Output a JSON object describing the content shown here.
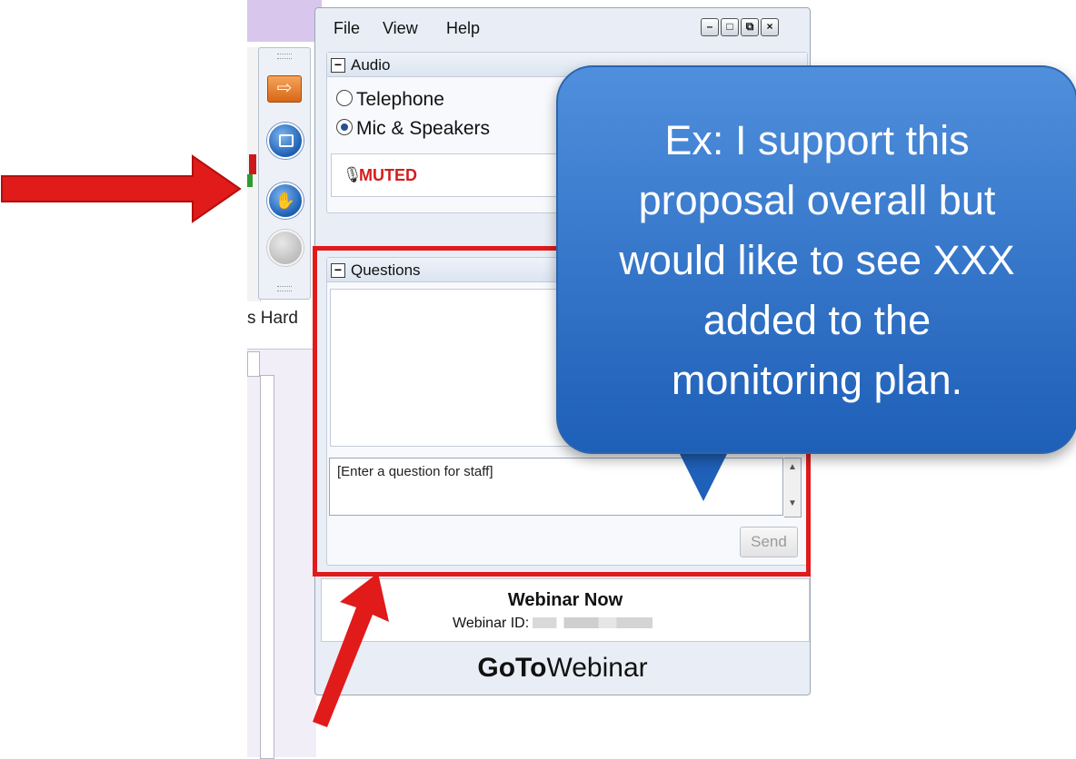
{
  "background_app": {
    "partial_label": "s Hard"
  },
  "menu": {
    "file": "File",
    "view": "View",
    "help": "Help"
  },
  "window_controls": {
    "minimize": "–",
    "maximize": "□",
    "restore": "⧉",
    "close": "×"
  },
  "audio": {
    "title": "Audio",
    "options": {
      "telephone": "Telephone",
      "mic_speakers": "Mic & Speakers"
    },
    "selected": "Mic & Speakers",
    "status": "MUTED"
  },
  "questions": {
    "title": "Questions",
    "input_placeholder": "[Enter a question for staff]",
    "send": "Send"
  },
  "webinar": {
    "title": "Webinar Now",
    "id_label": "Webinar ID:"
  },
  "brand": {
    "goto": "GoTo",
    "webinar": "Webinar"
  },
  "callout": {
    "lines": [
      "Ex: I support this",
      "proposal overall but",
      "would like to see XXX",
      "added to the",
      "monitoring plan."
    ]
  },
  "colors": {
    "accent_red": "#e11a1a",
    "callout_blue": "#2f72cc",
    "muted_red": "#d21e1e"
  }
}
